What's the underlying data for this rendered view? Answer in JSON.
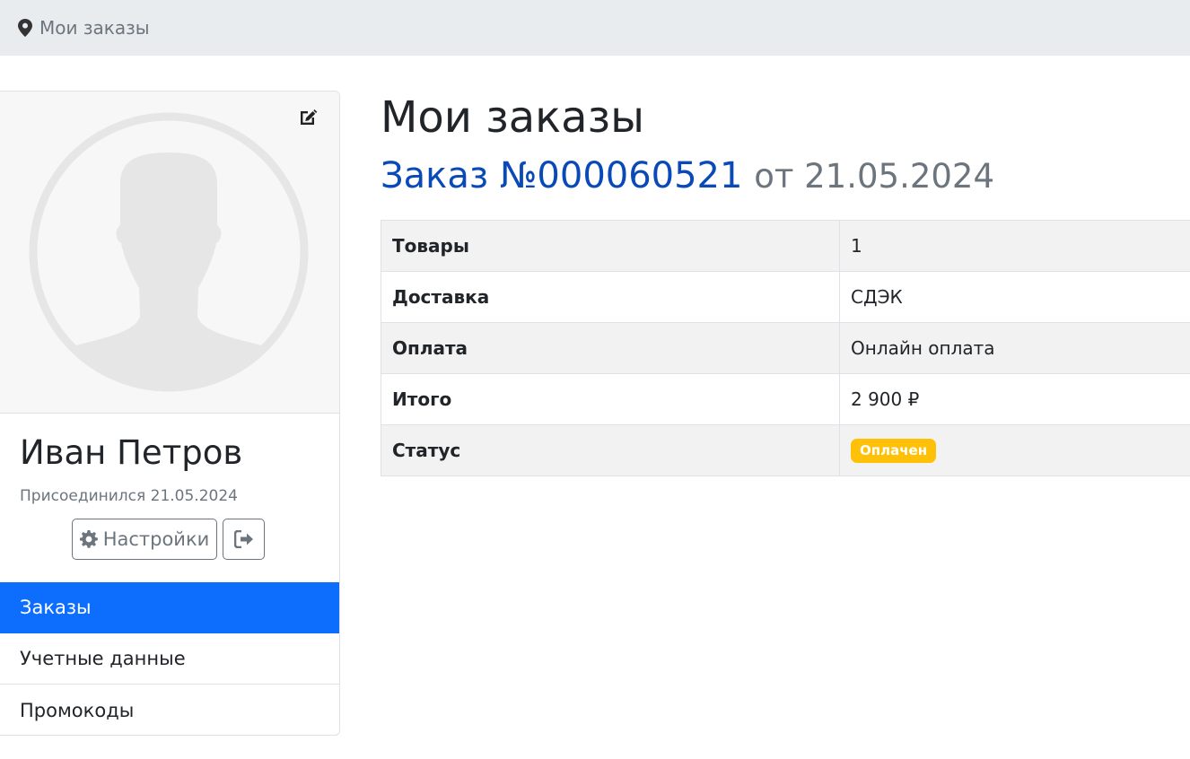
{
  "breadcrumb": {
    "icon": "map-marker-icon",
    "label": "Мои заказы"
  },
  "profile": {
    "name": "Иван Петров",
    "joined": "Присоединился 21.05.2024",
    "settings_label": "Настройки",
    "icons": {
      "avatar": "user-silhouette-icon",
      "edit": "edit-icon",
      "settings": "gear-icon",
      "logout": "sign-out-icon"
    }
  },
  "nav": {
    "items": [
      {
        "label": "Заказы",
        "active": true
      },
      {
        "label": "Учетные данные",
        "active": false
      },
      {
        "label": "Промокоды",
        "active": false
      }
    ]
  },
  "main": {
    "title": "Мои заказы",
    "order_link": "Заказ №000060521",
    "order_date": "от 21.05.2024",
    "rows": [
      {
        "label": "Товары",
        "value": "1"
      },
      {
        "label": "Доставка",
        "value": "СДЭК"
      },
      {
        "label": "Оплата",
        "value": "Онлайн оплата"
      },
      {
        "label": "Итого",
        "value": "2 900 ₽"
      },
      {
        "label": "Статус",
        "value": "Оплачен"
      }
    ]
  },
  "colors": {
    "primary": "#0d6efd",
    "link": "#0a49b8",
    "status_badge": "#ffc107",
    "muted": "#6c757d"
  }
}
